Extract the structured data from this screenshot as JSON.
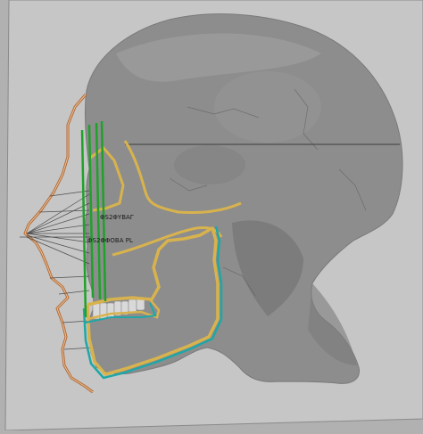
{
  "viewport": {
    "background": "#b1b1b1",
    "plane_color": "#c6c6c6",
    "plane_edge": "#8a8a8a"
  },
  "skull": {
    "fill": "#8d8d8d",
    "shade": "#6f6f6f",
    "highlight": "#a9a9a9"
  },
  "overlays": {
    "face_contour_color": "#b46a35",
    "feature_color": "#d8b34d",
    "jaw_color": "#1fa7a6",
    "guide_color": "#1fa12b",
    "construction_color": "#3a3a3a"
  },
  "labels": {
    "eye_readout": "ΦS2ΦΥΒΑΓ",
    "mid_readout": "ΦS2ΦΦΟΒΑ PL"
  }
}
